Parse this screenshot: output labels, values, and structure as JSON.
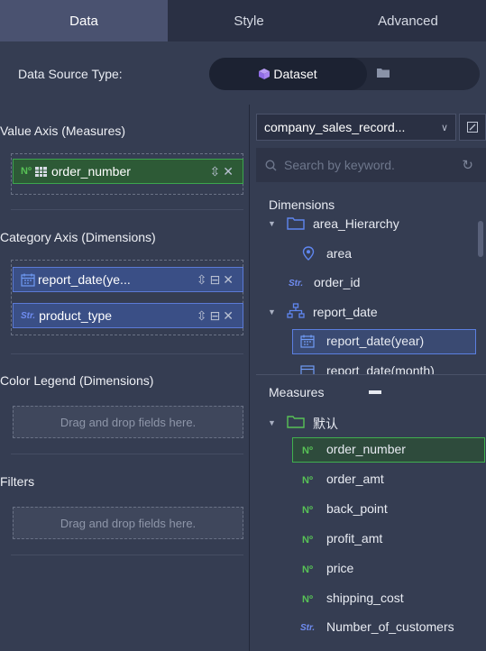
{
  "tabs": [
    {
      "label": "Data"
    },
    {
      "label": "Style"
    },
    {
      "label": "Advanced"
    }
  ],
  "data_source": {
    "label": "Data Source Type:",
    "active_option": "Dataset"
  },
  "left": {
    "value_axis": {
      "title": "Value Axis (Measures)",
      "field": {
        "badge": "Nº",
        "label": "order_number"
      }
    },
    "category_axis": {
      "title": "Category Axis (Dimensions)",
      "fields": [
        {
          "label": "report_date(ye..."
        },
        {
          "badge": "Str.",
          "label": "product_type"
        }
      ]
    },
    "color_legend": {
      "title": "Color Legend (Dimensions)",
      "placeholder": "Drag and drop fields here."
    },
    "filters": {
      "title": "Filters",
      "placeholder": "Drag and drop fields here."
    }
  },
  "right": {
    "dataset_name": "company_sales_record...",
    "search_placeholder": "Search by keyword.",
    "dimensions_title": "Dimensions",
    "dimensions": {
      "area_hierarchy": "area_Hierarchy",
      "area": "area",
      "order_id": {
        "badge": "Str.",
        "label": "order_id"
      },
      "report_date": "report_date",
      "report_date_year": "report_date(year)",
      "report_date_month": "report_date(month)"
    },
    "measures_title": "Measures",
    "measures_folder": "默认",
    "measures": [
      {
        "badge": "Nº",
        "label": "order_number"
      },
      {
        "badge": "Nº",
        "label": "order_amt"
      },
      {
        "badge": "Nº",
        "label": "back_point"
      },
      {
        "badge": "Nº",
        "label": "profit_amt"
      },
      {
        "badge": "Nº",
        "label": "price"
      },
      {
        "badge": "Nº",
        "label": "shipping_cost"
      },
      {
        "badge": "Str.",
        "label": "Number_of_customers"
      }
    ]
  },
  "colors": {
    "accent_green": "#3ca64e",
    "accent_blue": "#5b7ad6",
    "background": "#353d52"
  }
}
